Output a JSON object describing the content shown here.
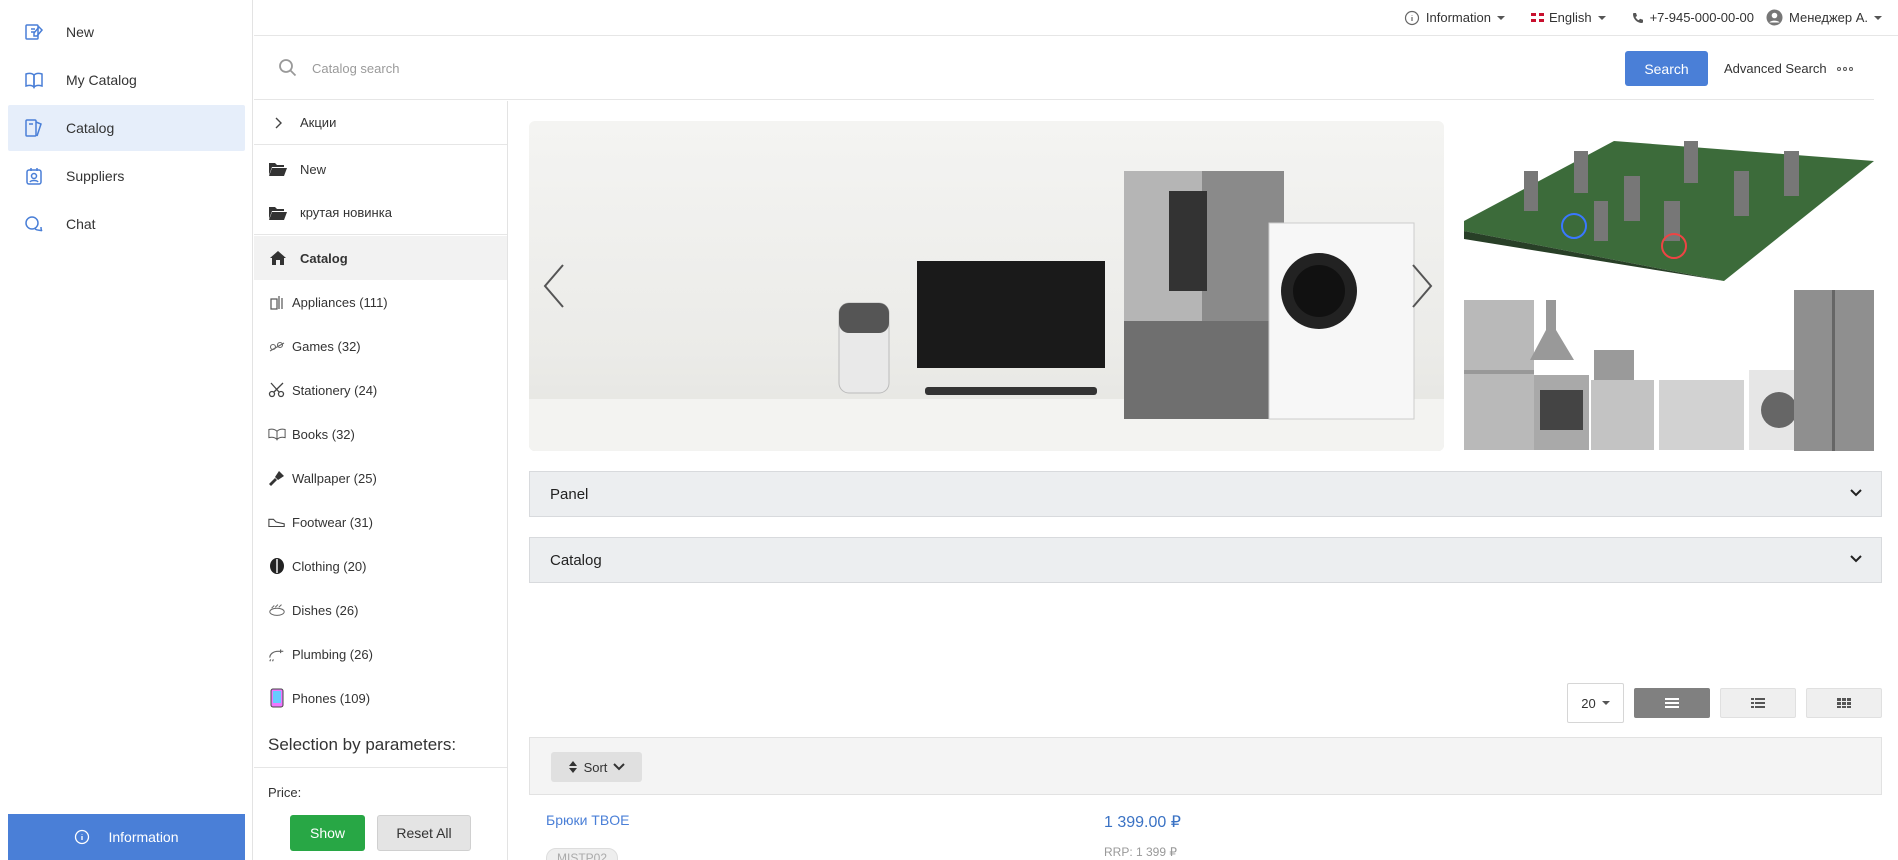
{
  "nav": {
    "items": [
      {
        "label": "New",
        "icon": "new-icon",
        "active": false
      },
      {
        "label": "My Catalog",
        "icon": "book-icon",
        "active": false
      },
      {
        "label": "Catalog",
        "icon": "catalog-icon",
        "active": true
      },
      {
        "label": "Suppliers",
        "icon": "suppliers-icon",
        "active": false
      },
      {
        "label": "Chat",
        "icon": "chat-icon",
        "active": false
      }
    ],
    "info_button": "Information"
  },
  "topbar": {
    "information": "Information",
    "language": "English",
    "phone": "+7-945-000-00-00",
    "user": "Менеджер А."
  },
  "search": {
    "placeholder": "Catalog search",
    "button": "Search",
    "advanced": "Advanced Search"
  },
  "categories": {
    "promo": "Акции",
    "folders": [
      "New",
      "крутая новинка"
    ],
    "catalog_head": "Catalog",
    "items": [
      "Appliances (111)",
      "Games (32)",
      "Stationery (24)",
      "Books (32)",
      "Wallpaper (25)",
      "Footwear (31)",
      "Clothing (20)",
      "Dishes (26)",
      "Plumbing (26)",
      "Phones (109)"
    ],
    "selection_title": "Selection by parameters:",
    "price_label": "Price:",
    "show_button": "Show",
    "reset_button": "Reset All"
  },
  "main": {
    "panel_label": "Panel",
    "catalog_label": "Catalog",
    "per_page": "20",
    "sort_label": "Sort",
    "product": {
      "name": "Брюки TBOE",
      "price": "1 399.00 ₽",
      "sku": "MISTP02",
      "rrp": "RRP: 1 399 ₽"
    }
  },
  "colors": {
    "accent": "#4a7fd7",
    "success": "#28a745",
    "active_nav_bg": "#e6eefa"
  }
}
